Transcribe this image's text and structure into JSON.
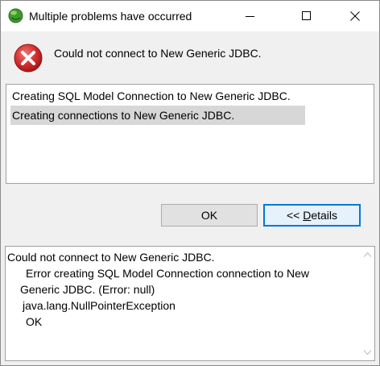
{
  "window": {
    "title": "Multiple problems have occurred"
  },
  "header": {
    "message": "Could not connect to New Generic JDBC.",
    "icon": "error-icon"
  },
  "problems": {
    "items": [
      {
        "label": "Creating SQL Model Connection to New Generic JDBC.",
        "selected": false
      },
      {
        "label": "Creating connections to New Generic JDBC.",
        "selected": true
      }
    ]
  },
  "buttons": {
    "ok_label": "OK",
    "details_prefix": "<< ",
    "details_mnemonic": "D",
    "details_rest": "etails"
  },
  "details": {
    "lines": [
      "Could not connect to New Generic JDBC.",
      "Error creating SQL Model Connection connection to New",
      "Generic JDBC. (Error: null)",
      "java.lang.NullPointerException",
      "OK"
    ]
  },
  "colors": {
    "error_red": "#d32f2f",
    "focus_blue": "#0078d7",
    "selection_gray": "#d7d7d7",
    "dialog_bg": "#f0f0f0"
  }
}
